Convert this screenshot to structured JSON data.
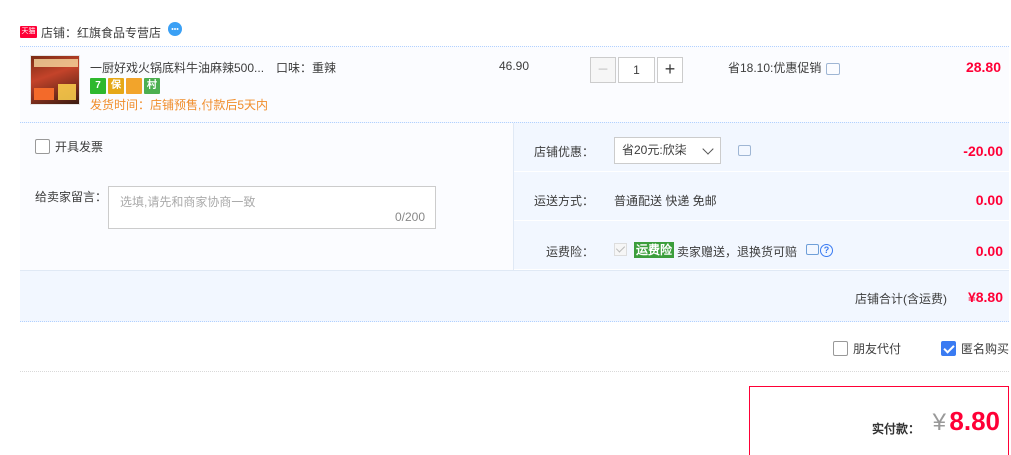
{
  "store": {
    "badge": "天猫",
    "label": "店铺：",
    "name": "红旗食品专营店",
    "chat_icon": "chat-bubble-icon"
  },
  "item": {
    "title": "一厨好戏火锅底料牛油麻辣500...",
    "spec": "口味：重辣",
    "services": [
      {
        "text": "7",
        "icon": "seven-day-return-icon"
      },
      {
        "text": "保",
        "icon": "guarantee-icon"
      },
      {
        "text": "",
        "icon": "credit-card-icon"
      },
      {
        "text": "村",
        "icon": "village-service-icon"
      }
    ],
    "ship_time": "发货时间：店铺预售,付款后5天内",
    "unit_price": "46.90",
    "quantity": "1",
    "qty_minus": "−",
    "qty_plus": "+",
    "promo": "省18.10:优惠促销",
    "total": "28.80"
  },
  "options": {
    "invoice_label": "开具发票",
    "message_label": "给卖家留言：",
    "message_placeholder": "选填,请先和商家协商一致",
    "message_count": "0/200",
    "coupon_label": "店铺优惠：",
    "coupon_selected": "省20元:欣柒",
    "coupon_value": "-20.00",
    "shipping_label": "运送方式：",
    "shipping_method": "普通配送 快递 免邮",
    "shipping_value": "0.00",
    "insurance_label": "运费险：",
    "insurance_tag": "运费险",
    "insurance_desc": "卖家赠送，退换货可赔",
    "insurance_value": "0.00",
    "insurance_help": "?"
  },
  "store_total": {
    "label": "店铺合计(含运费)",
    "value": "¥8.80"
  },
  "pay_options": {
    "friend_pay": "朋友代付",
    "anonymous": "匿名购买"
  },
  "payment": {
    "label": "实付款：",
    "yen": "¥",
    "amount": "8.80"
  },
  "colors": {
    "price_red": "#ff0036",
    "ship_orange": "#f08d2b",
    "checkbox_blue": "#3a7bf2"
  }
}
